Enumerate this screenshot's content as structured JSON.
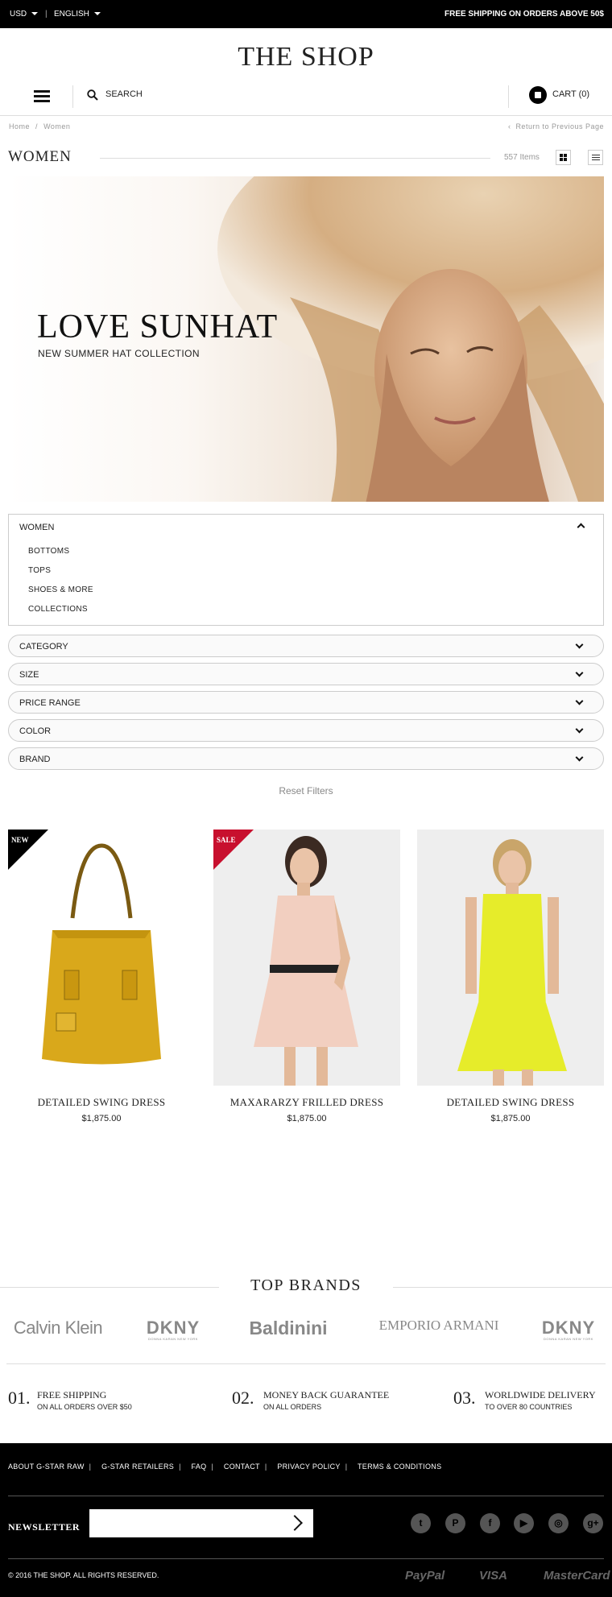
{
  "topbar": {
    "currency": "USD",
    "language": "ENGLISH",
    "separator": "|",
    "shipping_notice": "FREE SHIPPING ON ORDERS ABOVE 50$"
  },
  "header": {
    "logo": "THE SHOP",
    "search_label": "SEARCH",
    "cart_label": "CART (0)"
  },
  "breadcrumb": {
    "home": "Home",
    "sep": "/",
    "current": "Women",
    "return_link": "Return to Previous Page"
  },
  "page": {
    "title": "WOMEN",
    "item_count": "557 Items"
  },
  "hero": {
    "title": "LOVE SUNHAT",
    "subtitle": "NEW SUMMER HAT COLLECTION"
  },
  "women_panel": {
    "label": "WOMEN",
    "items": [
      "BOTTOMS",
      "TOPS",
      "SHOES & MORE",
      "COLLECTIONS"
    ]
  },
  "filters": [
    "CATEGORY",
    "SIZE",
    "PRICE RANGE",
    "COLOR",
    "BRAND"
  ],
  "reset_label": "Reset Filters",
  "products": [
    {
      "title": "DETAILED SWING DRESS",
      "price": "$1,875.00",
      "badge": "NEW",
      "badge_color": "#000000"
    },
    {
      "title": "MAXARARZY FRILLED DRESS",
      "price": "$1,875.00",
      "badge": "SALE",
      "badge_color": "#c8102e"
    },
    {
      "title": "DETAILED SWING DRESS",
      "price": "$1,875.00",
      "badge": "",
      "badge_color": ""
    }
  ],
  "brands": {
    "title": "TOP BRANDS",
    "items": [
      "Calvin Klein",
      "DKNY",
      "Baldinini",
      "EMPORIO ARMANI",
      "DKNY"
    ],
    "dkny_sub": "DONNA KARAN NEW YORK"
  },
  "features": [
    {
      "num": "01.",
      "title": "FREE SHIPPING",
      "sub": "ON ALL ORDERS OVER $50"
    },
    {
      "num": "02.",
      "title": "MONEY BACK GUARANTEE",
      "sub": "ON ALL ORDERS"
    },
    {
      "num": "03.",
      "title": "WORLDWIDE DELIVERY",
      "sub": "TO OVER 80 COUNTRIES"
    }
  ],
  "footer": {
    "links": [
      "ABOUT G-STAR RAW",
      "G-STAR RETAILERS",
      "FAQ",
      "CONTACT",
      "PRIVACY POLICY",
      "TERMS & CONDITIONS"
    ],
    "link_sep": "|",
    "newsletter_label": "NEWSLETTER",
    "newsletter_placeholder": "",
    "social": [
      "twitter-icon",
      "pinterest-icon",
      "facebook-icon",
      "youtube-icon",
      "instagram-icon",
      "google-plus-icon"
    ],
    "copyright": "© 2016 THE SHOP. ALL RIGHTS RESERVED.",
    "payments": [
      "PayPal",
      "VISA",
      "MasterCard"
    ]
  },
  "colors": {
    "accent": "#000000",
    "sale": "#c8102e"
  }
}
